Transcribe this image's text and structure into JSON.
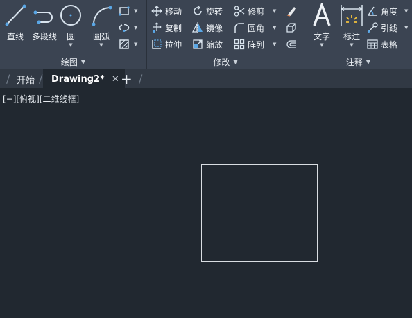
{
  "ribbon": {
    "draw": {
      "footer": "绘图",
      "line": "直线",
      "polyline": "多段线",
      "circle": "圆",
      "arc": "圆弧"
    },
    "modify": {
      "footer": "修改",
      "move": "移动",
      "rotate": "旋转",
      "trim": "修剪",
      "copy": "复制",
      "mirror": "镜像",
      "fillet": "圆角",
      "stretch": "拉伸",
      "scale": "缩放",
      "array": "阵列"
    },
    "annotation": {
      "footer": "注释",
      "text": "文字",
      "dimension": "标注",
      "angle": "角度",
      "leader": "引线",
      "table": "表格"
    }
  },
  "tabs": {
    "start": "开始",
    "drawing": "Drawing2*",
    "close_glyph": "✕",
    "add_glyph": "+"
  },
  "viewport": {
    "label": "[−][俯视][二维线框]"
  },
  "colors": {
    "ribbon_bg": "#3b4452",
    "canvas_bg": "#212830",
    "accent_blue": "#5aa7e6"
  }
}
